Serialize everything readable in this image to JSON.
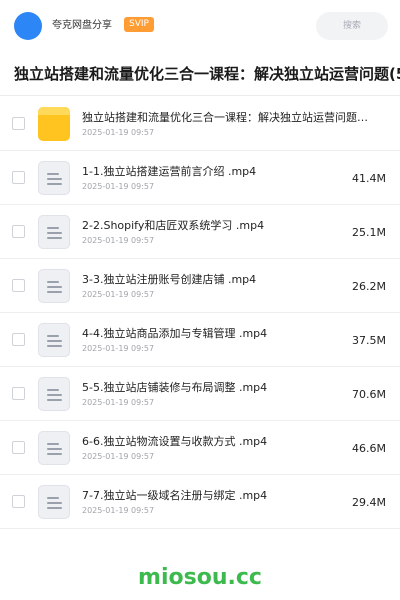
{
  "header": {
    "share_name": "夸克网盘分享",
    "badge": "SVIP",
    "search_placeholder": "搜索",
    "avatar_color": "#2c86f5"
  },
  "title": "独立站搭建和流量优化三合一课程：解决独立站运营问题(5",
  "files": [
    {
      "type": "folder",
      "icon": "folder-icon",
      "name": "独立站搭建和流量优化三合一课程：解决独立站运营问题…",
      "date": "2025-01-19 09:57",
      "size": ""
    },
    {
      "type": "file",
      "icon": "document-icon",
      "name": "1-1.独立站搭建运营前言介绍 .mp4",
      "date": "2025-01-19 09:57",
      "size": "41.4M"
    },
    {
      "type": "file",
      "icon": "document-icon",
      "name": "2-2.Shopify和店匠双系统学习 .mp4",
      "date": "2025-01-19 09:57",
      "size": "25.1M"
    },
    {
      "type": "file",
      "icon": "document-icon",
      "name": "3-3.独立站注册账号创建店铺 .mp4",
      "date": "2025-01-19 09:57",
      "size": "26.2M"
    },
    {
      "type": "file",
      "icon": "document-icon",
      "name": "4-4.独立站商品添加与专辑管理 .mp4",
      "date": "2025-01-19 09:57",
      "size": "37.5M"
    },
    {
      "type": "file",
      "icon": "document-icon",
      "name": "5-5.独立站店铺装修与布局调整 .mp4",
      "date": "2025-01-19 09:57",
      "size": "70.6M"
    },
    {
      "type": "file",
      "icon": "document-icon",
      "name": "6-6.独立站物流设置与收款方式 .mp4",
      "date": "2025-01-19 09:57",
      "size": "46.6M"
    },
    {
      "type": "file",
      "icon": "document-icon",
      "name": "7-7.独立站一级域名注册与绑定 .mp4",
      "date": "2025-01-19 09:57",
      "size": "29.4M"
    }
  ],
  "watermark": "miosou.cc",
  "colors": {
    "badge": "#ff9c34",
    "folder": "#ffc41f",
    "watermark": "#3dba4e"
  }
}
